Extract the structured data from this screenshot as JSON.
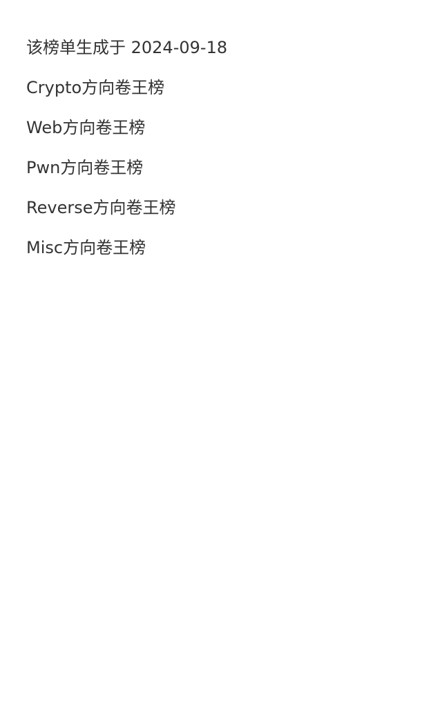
{
  "page": {
    "generated_text": "该榜单生成于 2024-09-18",
    "links": [
      {
        "label": "Crypto方向卷王榜"
      },
      {
        "label": "Web方向卷王榜"
      },
      {
        "label": "Pwn方向卷王榜"
      },
      {
        "label": "Reverse方向卷王榜"
      },
      {
        "label": "Misc方向卷王榜"
      }
    ],
    "colors": {
      "text": "#333333",
      "background": "#ffffff"
    }
  }
}
